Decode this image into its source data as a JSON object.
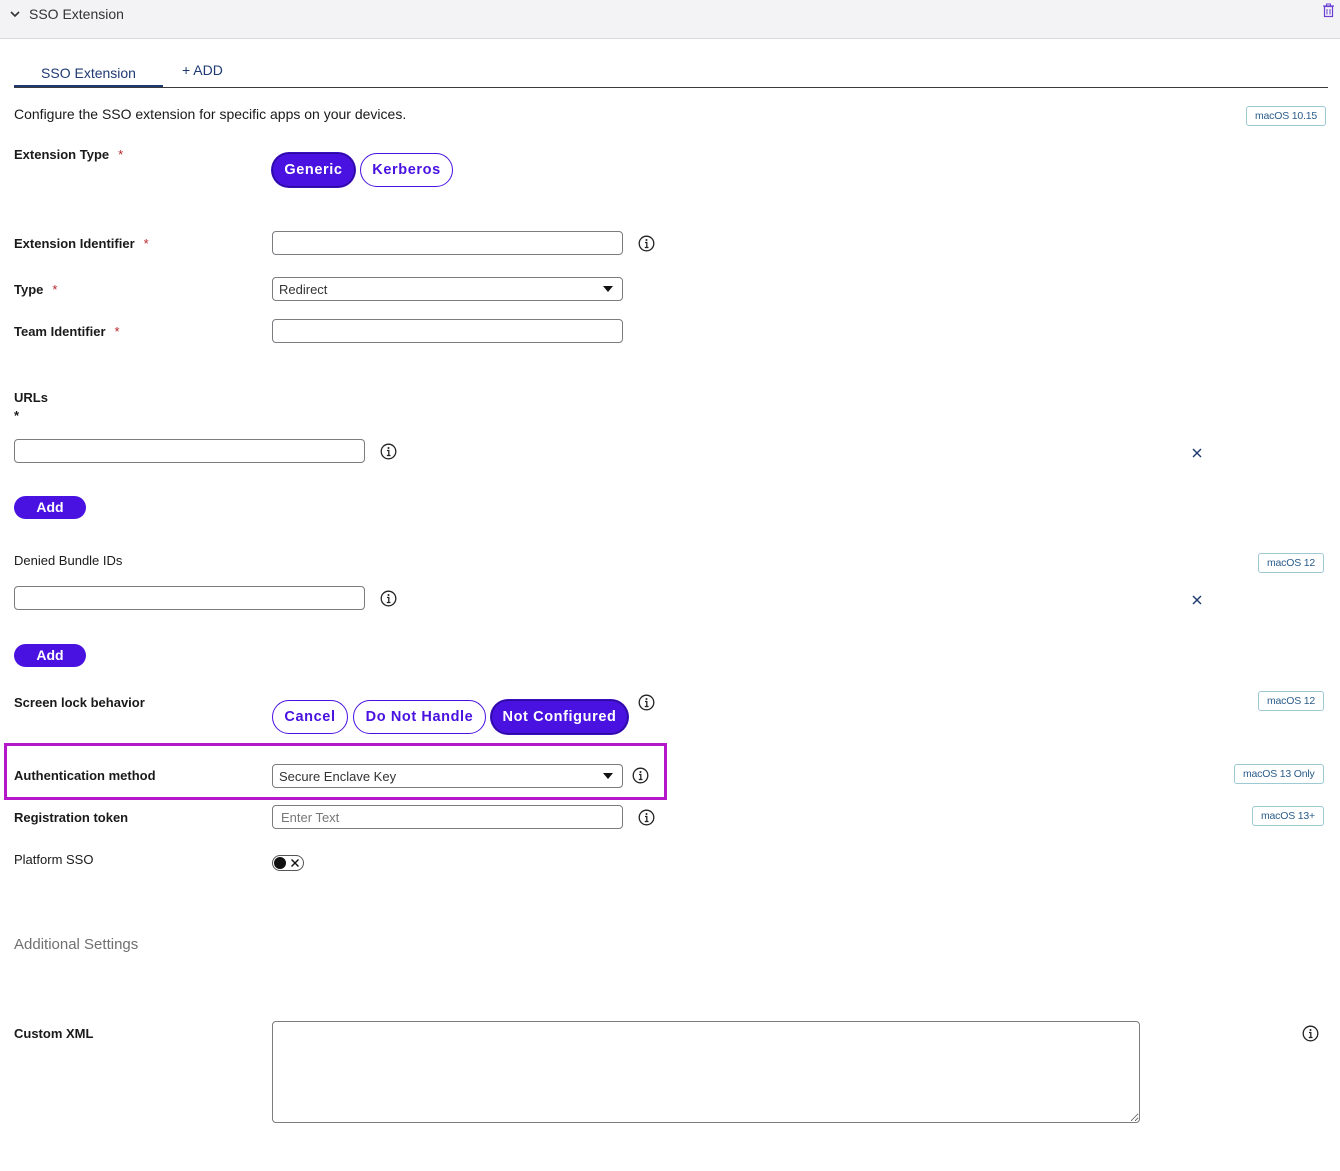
{
  "header": {
    "title": "SSO Extension"
  },
  "tabs": {
    "active_label": "SSO Extension",
    "add_label": "+ ADD"
  },
  "intro_text": "Configure the SSO extension for specific apps on your devices.",
  "badges": {
    "macos_1015": "macOS 10.15",
    "macos_12_denied": "macOS 12",
    "macos_12_screenlock": "macOS 12",
    "macos_13_only": "macOS 13 Only",
    "macos_13_plus": "macOS 13+"
  },
  "required_marker": "*",
  "extension_type": {
    "label": "Extension Type",
    "options": [
      "Generic",
      "Kerberos"
    ],
    "selected": "Generic"
  },
  "extension_identifier": {
    "label": "Extension Identifier",
    "value": ""
  },
  "type": {
    "label": "Type",
    "value": "Redirect"
  },
  "team_identifier": {
    "label": "Team Identifier",
    "value": ""
  },
  "urls": {
    "label": "URLs",
    "required_marker": "*",
    "value": "",
    "add_label": "Add"
  },
  "denied_bundle_ids": {
    "label": "Denied Bundle IDs",
    "value": "",
    "add_label": "Add"
  },
  "screen_lock_behavior": {
    "label": "Screen lock behavior",
    "options": [
      "Cancel",
      "Do Not Handle",
      "Not Configured"
    ],
    "selected": "Not Configured"
  },
  "authentication_method": {
    "label": "Authentication method",
    "value": "Secure Enclave Key"
  },
  "registration_token": {
    "label": "Registration token",
    "placeholder": "Enter Text",
    "value": ""
  },
  "platform_sso": {
    "label": "Platform SSO",
    "enabled": false
  },
  "additional_settings": {
    "title": "Additional Settings"
  },
  "custom_xml": {
    "label": "Custom XML",
    "value": ""
  },
  "colors": {
    "accent": "#4a12e0",
    "tab_active": "#1f3a73",
    "highlight": "#b418c9",
    "required": "#b5252a",
    "badge_border": "#9cc9d2"
  }
}
